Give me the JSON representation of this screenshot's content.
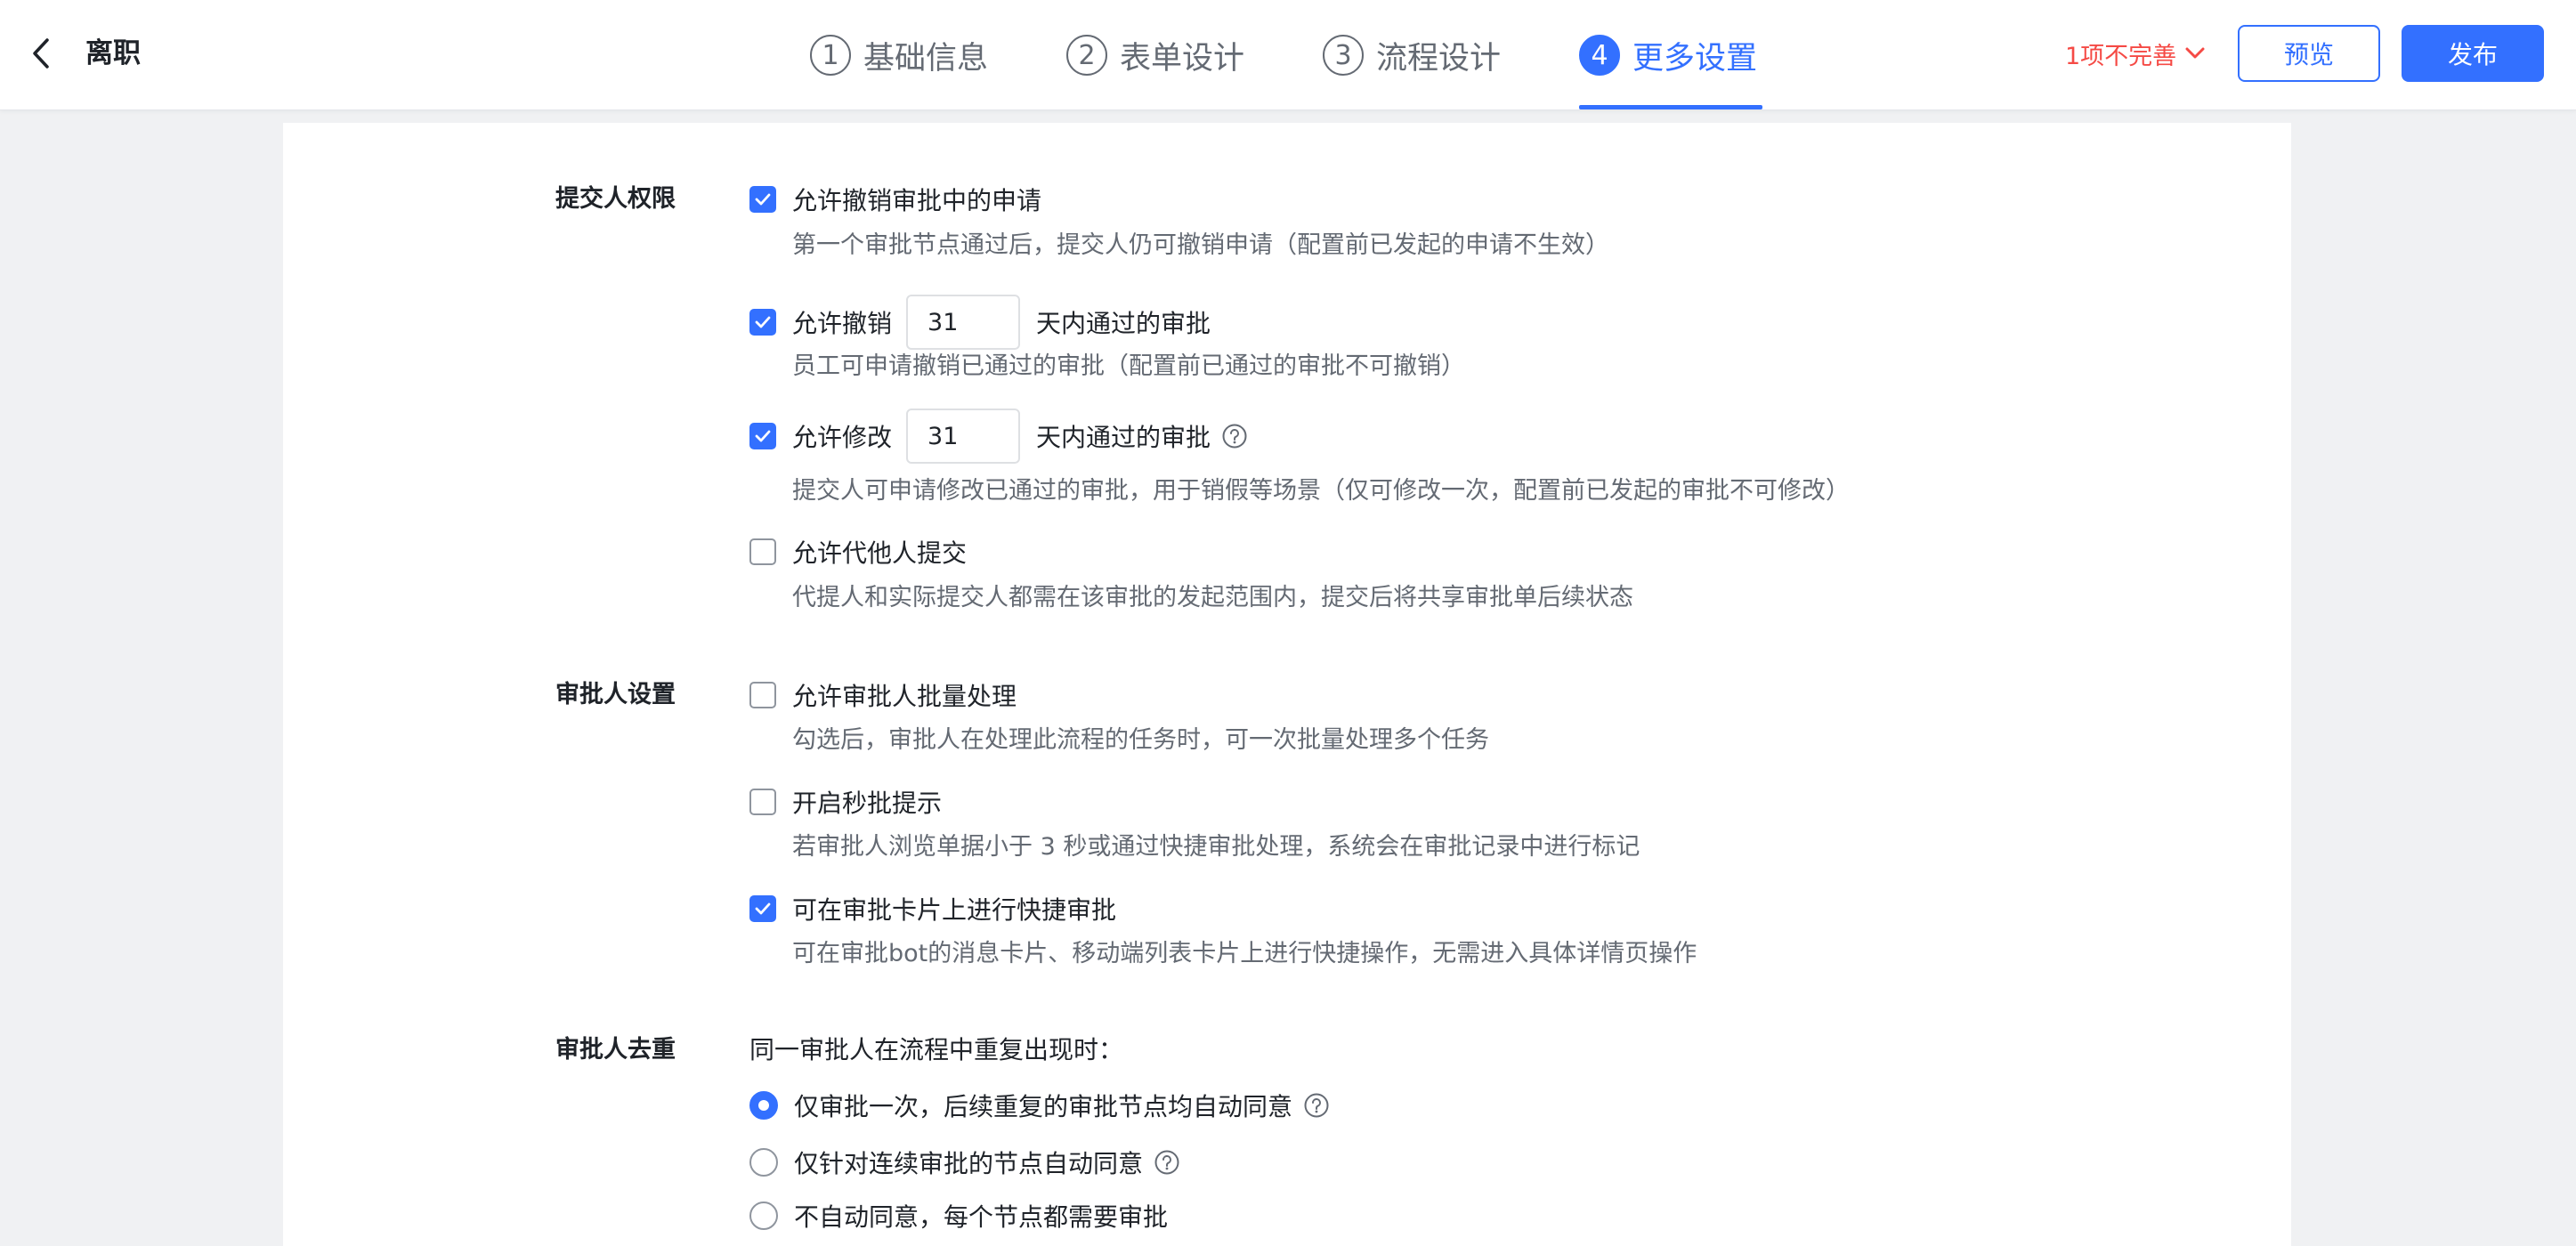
{
  "header": {
    "title": "离职",
    "steps": [
      {
        "num": "1",
        "label": "基础信息"
      },
      {
        "num": "2",
        "label": "表单设计"
      },
      {
        "num": "3",
        "label": "流程设计"
      },
      {
        "num": "4",
        "label": "更多设置",
        "active": true
      }
    ],
    "incomplete_label": "1项不完善",
    "preview_label": "预览",
    "publish_label": "发布"
  },
  "submitter": {
    "label": "提交人权限",
    "options": [
      {
        "label": "允许撤销审批中的申请",
        "checked": true,
        "desc": "第一个审批节点通过后，提交人仍可撤销申请（配置前已发起的申请不生效）"
      },
      {
        "label": "允许撤销",
        "checked": true,
        "value": "31",
        "suffix": "天内通过的审批",
        "desc": "员工可申请撤销已通过的审批（配置前已通过的审批不可撤销）"
      },
      {
        "label": "允许修改",
        "checked": true,
        "value": "31",
        "suffix": "天内通过的审批",
        "desc": "提交人可申请修改已通过的审批，用于销假等场景（仅可修改一次，配置前已发起的审批不可修改）"
      },
      {
        "label": "允许代他人提交",
        "checked": false,
        "desc": "代提人和实际提交人都需在该审批的发起范围内，提交后将共享审批单后续状态"
      }
    ]
  },
  "approver": {
    "label": "审批人设置",
    "options": [
      {
        "label": "允许审批人批量处理",
        "checked": false,
        "desc": "勾选后，审批人在处理此流程的任务时，可一次批量处理多个任务"
      },
      {
        "label": "开启秒批提示",
        "checked": false,
        "desc": "若审批人浏览单据小于 3 秒或通过快捷审批处理，系统会在审批记录中进行标记"
      },
      {
        "label": "可在审批卡片上进行快捷审批",
        "checked": true,
        "desc": "可在审批bot的消息卡片、移动端列表卡片上进行快捷操作，无需进入具体详情页操作"
      }
    ]
  },
  "dedupe": {
    "label": "审批人去重",
    "intro": "同一审批人在流程中重复出现时：",
    "options": [
      {
        "label": "仅审批一次，后续重复的审批节点均自动同意",
        "selected": true
      },
      {
        "label": "仅针对连续审批的节点自动同意",
        "selected": false
      },
      {
        "label": "不自动同意，每个节点都需要审批",
        "selected": false
      }
    ]
  },
  "colors": {
    "accent": "#3370ff",
    "danger": "#f54a45",
    "text": "#1f2329",
    "muted": "#646a73"
  }
}
